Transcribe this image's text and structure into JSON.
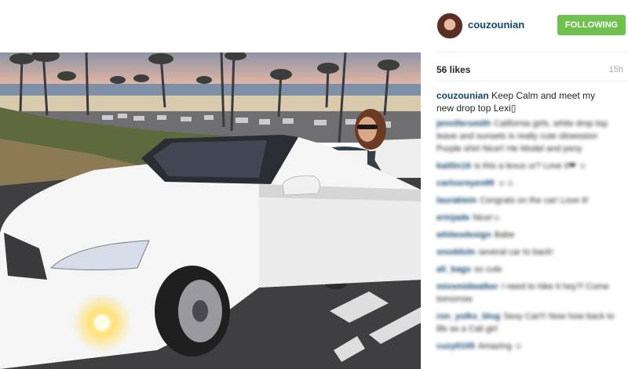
{
  "post": {
    "username": "couzounian",
    "follow_label": "FOLLOWING",
    "likes": "56 likes",
    "time": "15h",
    "caption_user": "couzounian",
    "caption_text": "Keep Calm and meet my new drop top Lexi▯",
    "photo_icon": "photo"
  },
  "comments": [
    {
      "user": "jennifersmith",
      "text": "California girls, white drop top leave and sunsets is really cute obsession Purple shirt Nice!! He Model and pony"
    },
    {
      "user": "kaitlin16",
      "text": "is this a lexus ur? Love it❤ ☺"
    },
    {
      "user": "carlosreyes99",
      "text": "☺☺"
    },
    {
      "user": "lauraklein",
      "text": "Congrats on the car! Love it!"
    },
    {
      "user": "erinjade",
      "text": "Nice!☺"
    },
    {
      "user": "whitesdesign",
      "text": "Babe"
    },
    {
      "user": "snoddoln",
      "text": "several car to back!"
    },
    {
      "user": "ali_bags",
      "text": "so cute"
    },
    {
      "user": "missmidwalker",
      "text": "I need to hike it hey?! Come tomorrow"
    },
    {
      "user": "ron_yolks_blog",
      "text": "Sexy Car!!! Now how back to life as a Cali girl"
    },
    {
      "user": "cuzy0105",
      "text": "Amazing ☺"
    }
  ]
}
